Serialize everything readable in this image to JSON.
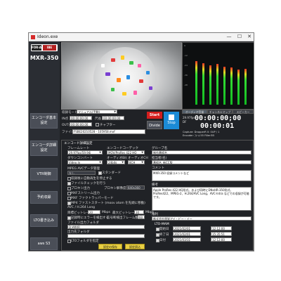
{
  "window": {
    "title": "Ideon.exe"
  },
  "window_controls": {
    "minimize": "—",
    "maximize": "☐",
    "close": "✕"
  },
  "sidebar": {
    "logo_left": "FOR-A",
    "logo_right": "IBE",
    "model": "MXR-350",
    "items": [
      {
        "label_line1": "エンコーダ基本",
        "label_line2": "設定"
      },
      {
        "label_line1": "エンコーダ詳細",
        "label_line2": "設定"
      },
      {
        "label_line1": "VTR制御",
        "label_line2": ""
      },
      {
        "label_line1": "予約収録",
        "label_line2": ""
      },
      {
        "label_line1": "LTO書き込み",
        "label_line2": ""
      },
      {
        "label_line1": "aws S3",
        "label_line2": ""
      }
    ]
  },
  "controls": {
    "record_mode_label": "収録モード",
    "record_mode_value": "マニュアル(手動)",
    "in_label": "IN点",
    "in_value": "00:00:00;00",
    "out_label": "OUT点",
    "out_value": "00:00:00;00",
    "chapter_label": "チャプター",
    "duration_label": "尺長",
    "duration_value": "00:00:00;00",
    "filename_label": "ファイル名",
    "filename_value": "FSBE20210528 - 105958.mxf",
    "start_label": "Start",
    "divide_label": "Divide",
    "stop_label": "Stop"
  },
  "monitor": {
    "tabs": [
      "オーディオ音量",
      "チャンネルマップ",
      "スピーカー"
    ],
    "timecode_label": "29.97fps",
    "timecode_sub": "DF",
    "timecode_top": "00:00:00;00",
    "timecode_bottom": "00:00:01",
    "capture_line": "Capture: DropperR 0: 0UP / 1",
    "encoder_line": "Encoder: ﾌﾚｰﾑ:55 Fillerl55"
  },
  "encoder": {
    "section_title": "エンコード詳細設定",
    "frame_rate_label": "フレームレート",
    "frame_rate_value": "29.97fps/59.94i",
    "codec_label": "エンコードコーデック",
    "codec_value": "MOV/ProRes 422 HQ",
    "downconvert_label": "ダウンコンバート",
    "downconvert_value": "Video In",
    "audio_bit_label": "オーディオBit",
    "audio_bit_value": "24bits",
    "audio_ch_label": "オーディオCH",
    "audio_ch_value": "8CH",
    "mpeg_section": "MPEG AVCデータ管理",
    "mpeg_none": "なし",
    "standard_label": "スタンダード",
    "opt_sync": "収録後に自動再生を停止する",
    "opt_proxy": "プロキシ出力",
    "opt_mxf": "MXFストリーム出力",
    "opt_file_check": "ファイルチェックを行う",
    "proxy_resolution_label": "プロキシ解像度",
    "proxy_resolution_value": "640x360",
    "opt_wrapper": "MXF ファクトラッパーモード",
    "opt_mp4": "MP4 ファストスタート (moov atom を先頭に移動)",
    "avc_label": "AVC / H.264 Long",
    "target_bitrate_label": "目標ビットレート",
    "target_bitrate_value": "20",
    "target_bitrate_unit": "Mbps",
    "max_bitrate_label": "最大ビットレート",
    "max_bitrate_value": "30",
    "max_bitrate_unit": "Mbps",
    "opt_audio_ticks": "記録時にエラーを検出する",
    "ticks_label": "信号断検出フレーム数",
    "ticks_value": "60",
    "file_folder_label": "ファイル出力フォルダ",
    "file_folder_value": "D:¥MXR",
    "output_folder_label": "出力先フォルダ",
    "output_folder_value": "",
    "opt_lto": "LTOフォルダを指定",
    "save_button": "設定の保存",
    "load_button": "設定読込"
  },
  "metadata": {
    "group_label": "グループ名",
    "group_value": "制作番組名",
    "person_label": "担当者(名)",
    "person_value": "番組名_新CC版",
    "comment_label": "コメント",
    "comment_value": "MXR-350 収録コメントなど",
    "memo_label": "備考",
    "memo_value": "Apple ProRes 422 HQ形式、および同時にDNxHR-350形式、ProRes422、MPEG-2、H.264/AVC Long、AVC-Intra などでの収録が可能です。",
    "owner_label": "権利",
    "owner_value": "株式会社朋栄アイ・ビー・イー"
  },
  "schedule": {
    "title": "LTO-MAM",
    "rows": [
      {
        "label": "開始日",
        "date": "2021/02/01",
        "time": "12:12:00"
      },
      {
        "label": "終了日",
        "date": "2021/02/01",
        "time": "15:35:51"
      },
      {
        "label": "日付",
        "date": "2021/03/31",
        "time": "12:12:00"
      }
    ]
  },
  "colors": {
    "window_bg": "#202226",
    "start": "#d41e1e",
    "stop": "#1b8bd6",
    "save": "#e8cf43",
    "meter_green": "#33dd33"
  },
  "audio_levels": [
    0.78,
    0.74,
    0.7,
    0.72,
    0.68,
    0.66,
    0.62,
    0.64
  ]
}
